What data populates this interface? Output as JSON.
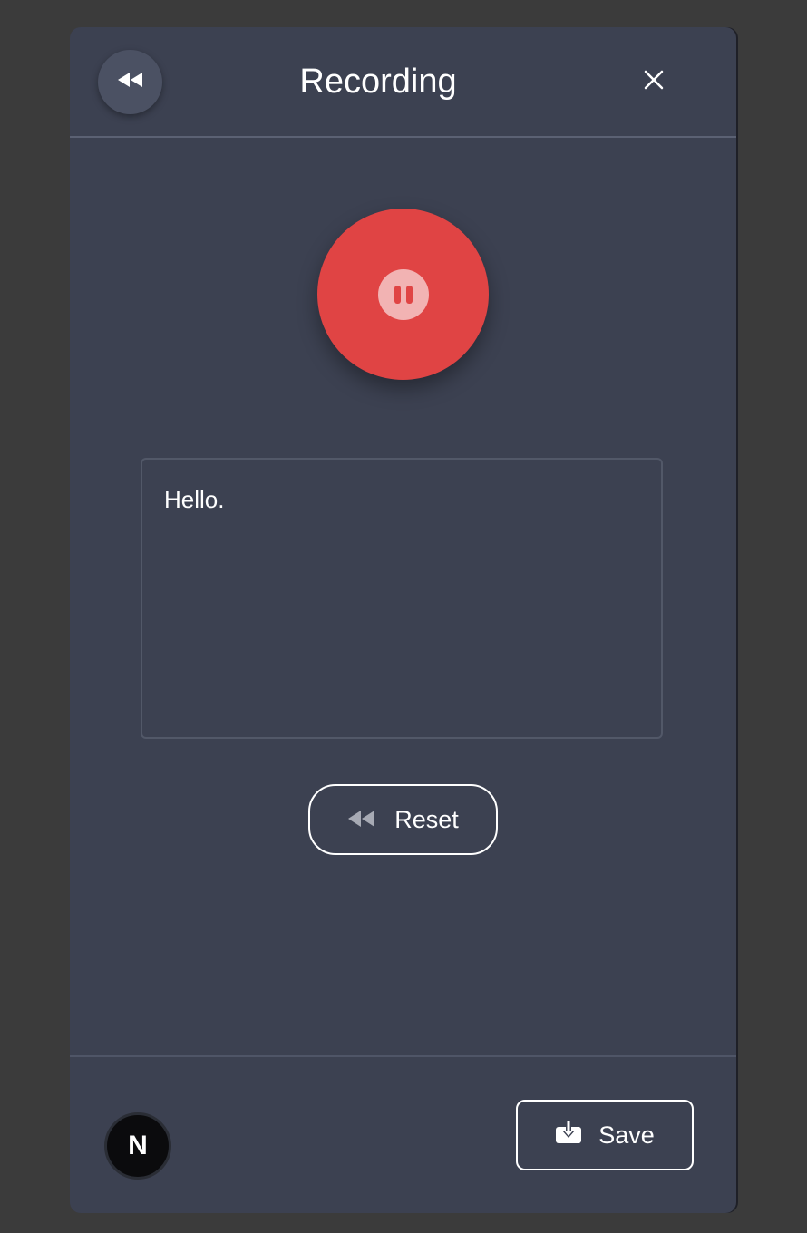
{
  "header": {
    "title": "Recording",
    "back_icon": "rewind-icon",
    "close_icon": "close-icon"
  },
  "recorder": {
    "state": "recording",
    "control_icon": "pause-icon",
    "accent_color": "#e04444"
  },
  "transcript": {
    "text": "Hello."
  },
  "reset_button": {
    "label": "Reset",
    "icon": "rewind-icon"
  },
  "footer": {
    "avatar_letter": "N",
    "save_label": "Save",
    "save_icon": "download-icon"
  },
  "colors": {
    "panel_bg": "#3c4151",
    "page_bg": "#3b3b3b",
    "text": "#ffffff"
  }
}
